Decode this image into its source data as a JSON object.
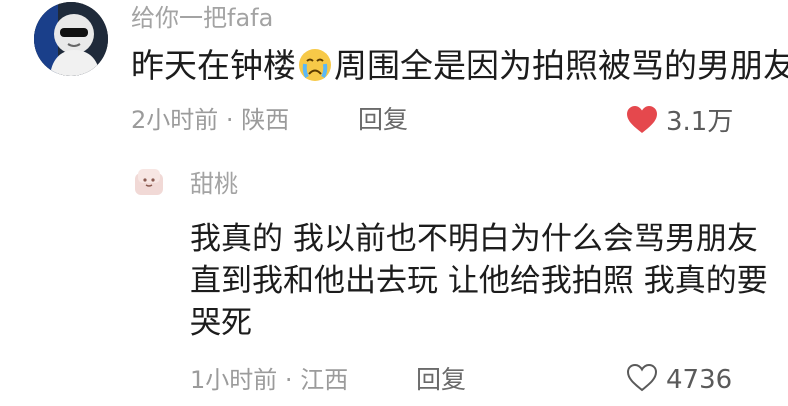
{
  "comment": {
    "username": "给你一把fafa",
    "text_before_emoji": "昨天在钟楼",
    "emoji": "crying-face-emoji",
    "text_after_emoji": "周围全是因为拍照被骂的男朋友",
    "time": "2小时前",
    "location": "陕西",
    "reply_label": "回复",
    "likes": "3.1万",
    "liked": true
  },
  "reply": {
    "username": "甜桃",
    "lines": [
      "我真的 我以前也不明白为什么会骂男朋友",
      "直到我和他出去玩 让他给我拍照 我真的要",
      "哭死"
    ],
    "time": "1小时前",
    "location": "江西",
    "reply_label": "回复",
    "likes": "4736",
    "liked": false
  },
  "colors": {
    "liked_heart": "#e5484d",
    "meta_text": "#9b9b9b",
    "body_text": "#1c1c1c"
  }
}
